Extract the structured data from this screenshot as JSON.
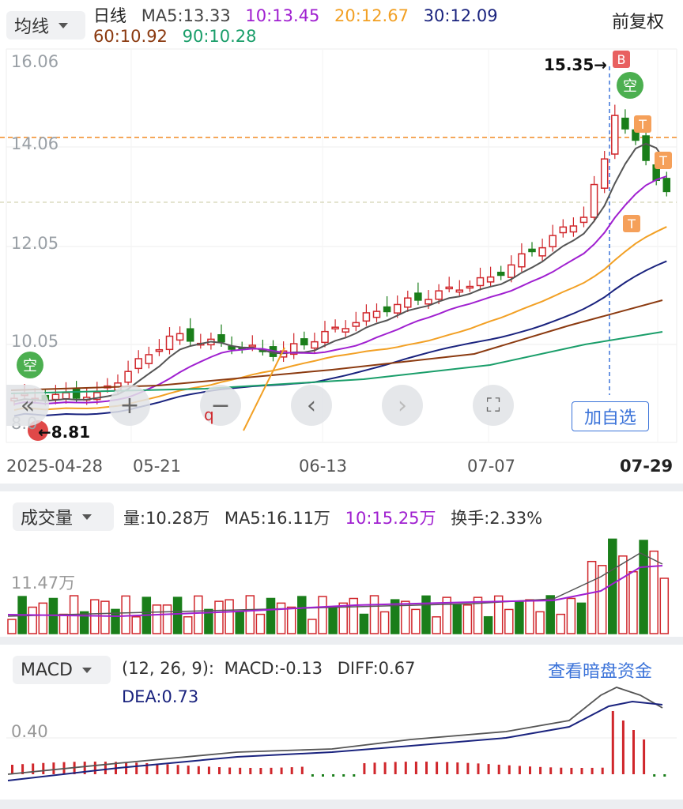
{
  "header": {
    "period_select": "均线",
    "period_label": "日线",
    "ma_values": [
      {
        "label": "MA5:13.33",
        "color": "#333333"
      },
      {
        "label": "10:13.45",
        "color": "#a020d0"
      },
      {
        "label": "20:12.67",
        "color": "#f2a024"
      },
      {
        "label": "30:12.09",
        "color": "#1a237e"
      },
      {
        "label": "60:10.92",
        "color": "#8b3a10"
      },
      {
        "label": "90:10.28",
        "color": "#1a9e6a"
      }
    ],
    "adjust_label": "前复权"
  },
  "price_axis": [
    "16.06",
    "14.06",
    "12.05",
    "10.05",
    "8.0"
  ],
  "dates": [
    "2025-04-28",
    "05-21",
    "06-13",
    "07-07",
    "07-29"
  ],
  "markers": {
    "high_label": "15.35",
    "low_label": "8.81",
    "buy": "B",
    "empty": "空",
    "sell": "T",
    "zoom_label": "q"
  },
  "controls": {
    "collapse_icon": "«",
    "zoom_in": "+",
    "zoom_out": "−",
    "prev": "‹",
    "next": "›",
    "fullscreen": "⛶",
    "add_favorite": "加自选"
  },
  "volume": {
    "select": "成交量",
    "vol_label": "量:10.28万",
    "ma5_label": "MA5:16.11万",
    "ma10_label": "10:15.25万",
    "turnover_label": "换手:2.33%",
    "axis_label": "11.47万"
  },
  "macd": {
    "select": "MACD",
    "params_label": "(12, 26, 9):",
    "macd_label": "MACD:-0.13",
    "diff_label": "DIFF:0.67",
    "dea_label": "DEA:0.73",
    "link_label": "查看暗盘资金",
    "axis_label": "0.40"
  },
  "colors": {
    "up": "#d0262b",
    "down": "#1a7e1a",
    "ma5": "#555555",
    "ma10": "#a020d0",
    "ma20": "#f2a024",
    "ma30": "#1a237e",
    "ma60": "#8b3a10",
    "ma90": "#1a9e6a",
    "link": "#3b73d9"
  }
}
